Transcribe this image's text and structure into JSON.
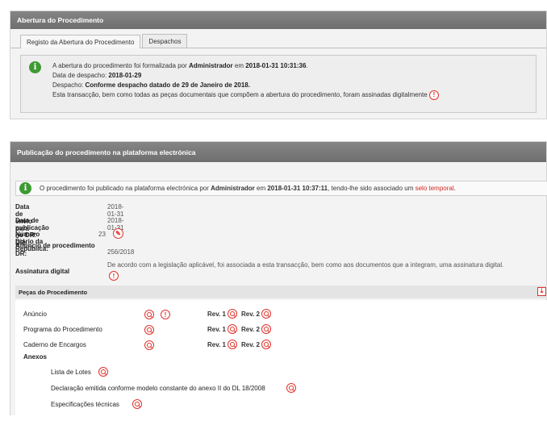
{
  "abertura": {
    "title": "Abertura do Procedimento",
    "tabs": [
      "Registo da Abertura do Procedimento",
      "Despachos"
    ],
    "line1_prefix": "A abertura do procedimento foi formalizada por ",
    "line1_user": "Administrador",
    "line1_mid": " em ",
    "line1_date": "2018-01-31 10:31:36",
    "line1_end": ".",
    "line2_label": "Data de despacho: ",
    "line2_value": "2018-01-29",
    "line3_label": "Despacho: ",
    "line3_value": "Conforme despacho datado de 29 de Janeiro de 2018.",
    "line4": "Esta transacção, bem como todas as peças documentais que compõem a abertura do procedimento, foram assinadas digitalmente"
  },
  "publicacao": {
    "title": "Publicação do procedimento na plataforma electrónica",
    "notice_prefix": "O procedimento foi publicado na plataforma electrónica por ",
    "notice_user": "Administrador",
    "notice_mid": " em ",
    "notice_date": "2018-01-31 10:37:11",
    "notice_mid2": ", tendo-lhe sido associado um ",
    "notice_link": "selo temporal",
    "notice_end": ".",
    "fields": {
      "envio_label": "Data de envio para o DR:",
      "envio_value": "2018-01-31",
      "publicacao_label": "Data de publicação no DR:",
      "publicacao_value": "2018-01-31",
      "numero_label": "Número Diário da República:",
      "numero_value": "23",
      "anuncio_label": "Anúncio de procedimento DR:",
      "anuncio_value": "256/2018",
      "assinatura_label": "Assinatura digital",
      "assinatura_value": "De acordo com a legislação aplicável, foi associada a esta transacção, bem como aos documentos que a integram, uma assinatura digital."
    }
  },
  "pecas": {
    "title": "Peças do Procedimento",
    "items": [
      {
        "name": "Anúncio",
        "rev1": "Rev. 1",
        "rev2": "Rev. 2"
      },
      {
        "name": "Programa do Procedimento",
        "rev1": "Rev. 1",
        "rev2": "Rev. 2"
      },
      {
        "name": "Caderno de Encargos",
        "rev1": "Rev. 1",
        "rev2": "Rev. 2"
      }
    ],
    "anexos_label": "Anexos",
    "anexos": [
      "Lista de Lotes",
      "Declaração emitida conforme modelo constante do anexo II do DL 18/2008",
      "Especificações técnicas"
    ]
  },
  "icons": {
    "info": "info-icon",
    "seal": "seal-icon",
    "view": "magnifier-icon",
    "edit": "edit-icon",
    "download": "download-icon"
  },
  "colors": {
    "header": "#7a7a7a",
    "accent_red": "#e2312b",
    "info_green": "#3e9a34"
  }
}
